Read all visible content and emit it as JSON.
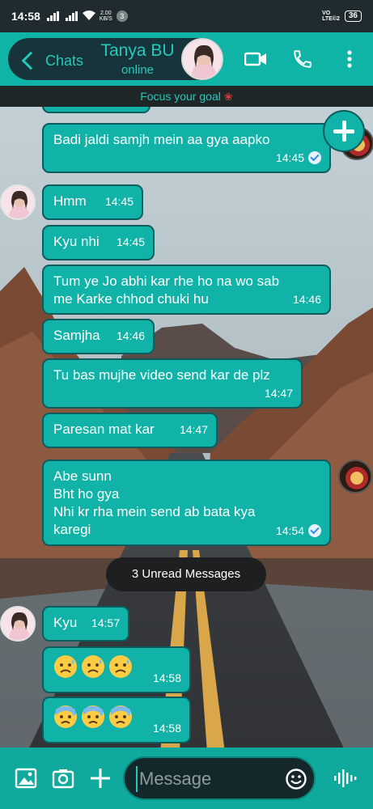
{
  "status_bar": {
    "time": "14:58",
    "net_speed_value": "2.00",
    "net_speed_unit": "KB/S",
    "notification_count": "3",
    "volte_top": "VO",
    "volte_bottom": "LTE©2",
    "battery": "36"
  },
  "header": {
    "back_label": "Chats",
    "contact_name": "Tanya BU",
    "contact_status": "online",
    "icons": [
      "back-chevron-icon",
      "video-call-icon",
      "phone-icon",
      "more-vert-icon"
    ]
  },
  "focus_banner": {
    "text": "Focus your goal",
    "icon": "rose-icon"
  },
  "messages": [
    {
      "id": "m1",
      "direction": "outgoing",
      "text": "Badi jaldi samjh mein aa gya aapko",
      "time": "14:45",
      "read": true
    },
    {
      "id": "m2",
      "direction": "incoming",
      "text": "Hmm",
      "time": "14:45"
    },
    {
      "id": "m3",
      "direction": "incoming",
      "text": "Kyu nhi",
      "time": "14:45"
    },
    {
      "id": "m4",
      "direction": "incoming",
      "text": "Tum ye Jo abhi kar rhe ho na wo sab\nme Karke chhod chuki hu",
      "time": "14:46"
    },
    {
      "id": "m5",
      "direction": "incoming",
      "text": "Samjha",
      "time": "14:46"
    },
    {
      "id": "m6",
      "direction": "incoming",
      "text": "Tu bas mujhe video send kar de plz",
      "time": "14:47"
    },
    {
      "id": "m7",
      "direction": "incoming",
      "text": "Paresan mat kar",
      "time": "14:47"
    },
    {
      "id": "m8",
      "direction": "outgoing",
      "text": "Abe sunn\nBht ho gya\nNhi kr rha mein send ab bata kya\nkaregi",
      "time": "14:54",
      "read": true
    },
    {
      "id": "m9",
      "direction": "incoming",
      "text": "Kyu",
      "time": "14:57"
    },
    {
      "id": "m10",
      "direction": "incoming",
      "emojis": [
        "sad-sweat-face",
        "sad-sweat-face",
        "sad-sweat-face"
      ],
      "time": "14:58"
    },
    {
      "id": "m11",
      "direction": "incoming",
      "emojis": [
        "anxious-sweat-face",
        "anxious-sweat-face",
        "anxious-sweat-face"
      ],
      "time": "14:58"
    }
  ],
  "unread_divider": "3 Unread Messages",
  "composer": {
    "placeholder": "Message",
    "value": "",
    "icons": [
      "gallery-icon",
      "camera-icon",
      "plus-icon",
      "emoji-icon",
      "voice-wave-icon"
    ]
  },
  "fab_icon": "add-icon",
  "colors": {
    "accent": "#0fb4a7",
    "bubble": "#11b3a8",
    "bubble_border": "#0b5c5c",
    "header_text": "#23c9bb",
    "dark": "#16343a"
  }
}
